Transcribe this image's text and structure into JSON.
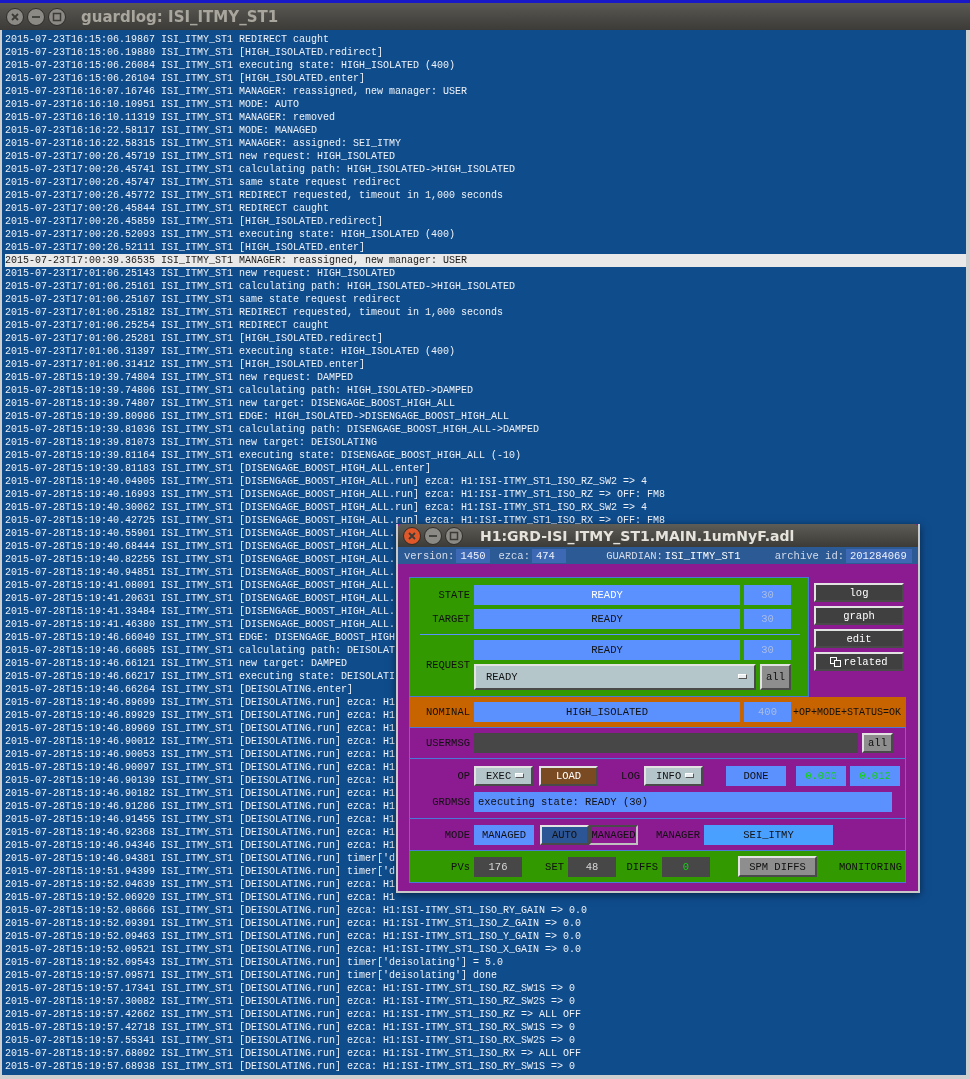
{
  "window": {
    "title": "guardlog: ISI_ITMY_ST1"
  },
  "log": {
    "lines": [
      {
        "text": "2015-07-23T16:15:06.19867 ISI_ITMY_ST1 REDIRECT caught",
        "selected": false
      },
      {
        "text": "2015-07-23T16:15:06.19880 ISI_ITMY_ST1 [HIGH_ISOLATED.redirect]",
        "selected": false
      },
      {
        "text": "2015-07-23T16:15:06.26084 ISI_ITMY_ST1 executing state: HIGH_ISOLATED (400)",
        "selected": false
      },
      {
        "text": "2015-07-23T16:15:06.26104 ISI_ITMY_ST1 [HIGH_ISOLATED.enter]",
        "selected": false
      },
      {
        "text": "2015-07-23T16:16:07.16746 ISI_ITMY_ST1 MANAGER: reassigned, new manager: USER",
        "selected": false
      },
      {
        "text": "2015-07-23T16:16:10.10951 ISI_ITMY_ST1 MODE: AUTO",
        "selected": false
      },
      {
        "text": "2015-07-23T16:16:10.11319 ISI_ITMY_ST1 MANAGER: removed",
        "selected": false
      },
      {
        "text": "2015-07-23T16:16:22.58117 ISI_ITMY_ST1 MODE: MANAGED",
        "selected": false
      },
      {
        "text": "2015-07-23T16:16:22.58315 ISI_ITMY_ST1 MANAGER: assigned: SEI_ITMY",
        "selected": false
      },
      {
        "text": "2015-07-23T17:00:26.45719 ISI_ITMY_ST1 new request: HIGH_ISOLATED",
        "selected": false
      },
      {
        "text": "2015-07-23T17:00:26.45741 ISI_ITMY_ST1 calculating path: HIGH_ISOLATED->HIGH_ISOLATED",
        "selected": false
      },
      {
        "text": "2015-07-23T17:00:26.45747 ISI_ITMY_ST1 same state request redirect",
        "selected": false
      },
      {
        "text": "2015-07-23T17:00:26.45772 ISI_ITMY_ST1 REDIRECT requested, timeout in 1,000 seconds",
        "selected": false
      },
      {
        "text": "2015-07-23T17:00:26.45844 ISI_ITMY_ST1 REDIRECT caught",
        "selected": false
      },
      {
        "text": "2015-07-23T17:00:26.45859 ISI_ITMY_ST1 [HIGH_ISOLATED.redirect]",
        "selected": false
      },
      {
        "text": "2015-07-23T17:00:26.52093 ISI_ITMY_ST1 executing state: HIGH_ISOLATED (400)",
        "selected": false
      },
      {
        "text": "2015-07-23T17:00:26.52111 ISI_ITMY_ST1 [HIGH_ISOLATED.enter]",
        "selected": false
      },
      {
        "text": "2015-07-23T17:00:39.36535 ISI_ITMY_ST1 MANAGER: reassigned, new manager: USER",
        "selected": true
      },
      {
        "text": "2015-07-23T17:01:06.25143 ISI_ITMY_ST1 new request: HIGH_ISOLATED",
        "selected": false
      },
      {
        "text": "2015-07-23T17:01:06.25161 ISI_ITMY_ST1 calculating path: HIGH_ISOLATED->HIGH_ISOLATED",
        "selected": false
      },
      {
        "text": "2015-07-23T17:01:06.25167 ISI_ITMY_ST1 same state request redirect",
        "selected": false
      },
      {
        "text": "2015-07-23T17:01:06.25182 ISI_ITMY_ST1 REDIRECT requested, timeout in 1,000 seconds",
        "selected": false
      },
      {
        "text": "2015-07-23T17:01:06.25254 ISI_ITMY_ST1 REDIRECT caught",
        "selected": false
      },
      {
        "text": "2015-07-23T17:01:06.25281 ISI_ITMY_ST1 [HIGH_ISOLATED.redirect]",
        "selected": false
      },
      {
        "text": "2015-07-23T17:01:06.31397 ISI_ITMY_ST1 executing state: HIGH_ISOLATED (400)",
        "selected": false
      },
      {
        "text": "2015-07-23T17:01:06.31412 ISI_ITMY_ST1 [HIGH_ISOLATED.enter]",
        "selected": false
      },
      {
        "text": "2015-07-28T15:19:39.74804 ISI_ITMY_ST1 new request: DAMPED",
        "selected": false
      },
      {
        "text": "2015-07-28T15:19:39.74806 ISI_ITMY_ST1 calculating path: HIGH_ISOLATED->DAMPED",
        "selected": false
      },
      {
        "text": "2015-07-28T15:19:39.74807 ISI_ITMY_ST1 new target: DISENGAGE_BOOST_HIGH_ALL",
        "selected": false
      },
      {
        "text": "2015-07-28T15:19:39.80986 ISI_ITMY_ST1 EDGE: HIGH_ISOLATED->DISENGAGE_BOOST_HIGH_ALL",
        "selected": false
      },
      {
        "text": "2015-07-28T15:19:39.81036 ISI_ITMY_ST1 calculating path: DISENGAGE_BOOST_HIGH_ALL->DAMPED",
        "selected": false
      },
      {
        "text": "2015-07-28T15:19:39.81073 ISI_ITMY_ST1 new target: DEISOLATING",
        "selected": false
      },
      {
        "text": "2015-07-28T15:19:39.81164 ISI_ITMY_ST1 executing state: DISENGAGE_BOOST_HIGH_ALL (-10)",
        "selected": false
      },
      {
        "text": "2015-07-28T15:19:39.81183 ISI_ITMY_ST1 [DISENGAGE_BOOST_HIGH_ALL.enter]",
        "selected": false
      },
      {
        "text": "2015-07-28T15:19:40.04905 ISI_ITMY_ST1 [DISENGAGE_BOOST_HIGH_ALL.run] ezca: H1:ISI-ITMY_ST1_ISO_RZ_SW2 => 4",
        "selected": false
      },
      {
        "text": "2015-07-28T15:19:40.16993 ISI_ITMY_ST1 [DISENGAGE_BOOST_HIGH_ALL.run] ezca: H1:ISI-ITMY_ST1_ISO_RZ => OFF: FM8",
        "selected": false
      },
      {
        "text": "2015-07-28T15:19:40.30062 ISI_ITMY_ST1 [DISENGAGE_BOOST_HIGH_ALL.run] ezca: H1:ISI-ITMY_ST1_ISO_RX_SW2 => 4",
        "selected": false
      },
      {
        "text": "2015-07-28T15:19:40.42725 ISI_ITMY_ST1 [DISENGAGE_BOOST_HIGH_ALL.run] ezca: H1:ISI-ITMY_ST1_ISO_RX => OFF: FM8",
        "selected": false
      },
      {
        "text": "2015-07-28T15:19:40.55901 ISI_ITMY_ST1 [DISENGAGE_BOOST_HIGH_ALL.",
        "selected": false
      },
      {
        "text": "2015-07-28T15:19:40.68444 ISI_ITMY_ST1 [DISENGAGE_BOOST_HIGH_ALL.",
        "selected": false
      },
      {
        "text": "2015-07-28T15:19:40.82255 ISI_ITMY_ST1 [DISENGAGE_BOOST_HIGH_ALL.",
        "selected": false
      },
      {
        "text": "2015-07-28T15:19:40.94851 ISI_ITMY_ST1 [DISENGAGE_BOOST_HIGH_ALL.",
        "selected": false
      },
      {
        "text": "2015-07-28T15:19:41.08091 ISI_ITMY_ST1 [DISENGAGE_BOOST_HIGH_ALL.",
        "selected": false
      },
      {
        "text": "2015-07-28T15:19:41.20631 ISI_ITMY_ST1 [DISENGAGE_BOOST_HIGH_ALL.",
        "selected": false
      },
      {
        "text": "2015-07-28T15:19:41.33484 ISI_ITMY_ST1 [DISENGAGE_BOOST_HIGH_ALL.",
        "selected": false
      },
      {
        "text": "2015-07-28T15:19:41.46380 ISI_ITMY_ST1 [DISENGAGE_BOOST_HIGH_ALL.",
        "selected": false
      },
      {
        "text": "2015-07-28T15:19:46.66040 ISI_ITMY_ST1 EDGE: DISENGAGE_BOOST_HIGH",
        "selected": false
      },
      {
        "text": "2015-07-28T15:19:46.66085 ISI_ITMY_ST1 calculating path: DEISOLAT",
        "selected": false
      },
      {
        "text": "2015-07-28T15:19:46.66121 ISI_ITMY_ST1 new target: DAMPED",
        "selected": false
      },
      {
        "text": "2015-07-28T15:19:46.66217 ISI_ITMY_ST1 executing state: DEISOLATI",
        "selected": false
      },
      {
        "text": "2015-07-28T15:19:46.66264 ISI_ITMY_ST1 [DEISOLATING.enter]",
        "selected": false
      },
      {
        "text": "2015-07-28T15:19:46.89699 ISI_ITMY_ST1 [DEISOLATING.run] ezca: H1",
        "selected": false
      },
      {
        "text": "2015-07-28T15:19:46.89929 ISI_ITMY_ST1 [DEISOLATING.run] ezca: H1",
        "selected": false
      },
      {
        "text": "2015-07-28T15:19:46.89969 ISI_ITMY_ST1 [DEISOLATING.run] ezca: H1",
        "selected": false
      },
      {
        "text": "2015-07-28T15:19:46.90012 ISI_ITMY_ST1 [DEISOLATING.run] ezca: H1",
        "selected": false
      },
      {
        "text": "2015-07-28T15:19:46.90053 ISI_ITMY_ST1 [DEISOLATING.run] ezca: H1",
        "selected": false
      },
      {
        "text": "2015-07-28T15:19:46.90097 ISI_ITMY_ST1 [DEISOLATING.run] ezca: H1",
        "selected": false
      },
      {
        "text": "2015-07-28T15:19:46.90139 ISI_ITMY_ST1 [DEISOLATING.run] ezca: H1",
        "selected": false
      },
      {
        "text": "2015-07-28T15:19:46.90182 ISI_ITMY_ST1 [DEISOLATING.run] ezca: H1",
        "selected": false
      },
      {
        "text": "2015-07-28T15:19:46.91286 ISI_ITMY_ST1 [DEISOLATING.run] ezca: H1",
        "selected": false
      },
      {
        "text": "2015-07-28T15:19:46.91455 ISI_ITMY_ST1 [DEISOLATING.run] ezca: H1",
        "selected": false
      },
      {
        "text": "2015-07-28T15:19:46.92368 ISI_ITMY_ST1 [DEISOLATING.run] ezca: H1",
        "selected": false
      },
      {
        "text": "2015-07-28T15:19:46.94346 ISI_ITMY_ST1 [DEISOLATING.run] ezca: H1",
        "selected": false
      },
      {
        "text": "2015-07-28T15:19:46.94381 ISI_ITMY_ST1 [DEISOLATING.run] timer['d",
        "selected": false
      },
      {
        "text": "2015-07-28T15:19:51.94399 ISI_ITMY_ST1 [DEISOLATING.run] timer['d",
        "selected": false
      },
      {
        "text": "2015-07-28T15:19:52.04639 ISI_ITMY_ST1 [DEISOLATING.run] ezca: H1",
        "selected": false
      },
      {
        "text": "2015-07-28T15:19:52.06920 ISI_ITMY_ST1 [DEISOLATING.run] ezca: H1",
        "selected": false
      },
      {
        "text": "2015-07-28T15:19:52.08666 ISI_ITMY_ST1 [DEISOLATING.run] ezca: H1:ISI-ITMY_ST1_ISO_RY_GAIN => 0.0",
        "selected": false
      },
      {
        "text": "2015-07-28T15:19:52.09391 ISI_ITMY_ST1 [DEISOLATING.run] ezca: H1:ISI-ITMY_ST1_ISO_Z_GAIN => 0.0",
        "selected": false
      },
      {
        "text": "2015-07-28T15:19:52.09463 ISI_ITMY_ST1 [DEISOLATING.run] ezca: H1:ISI-ITMY_ST1_ISO_Y_GAIN => 0.0",
        "selected": false
      },
      {
        "text": "2015-07-28T15:19:52.09521 ISI_ITMY_ST1 [DEISOLATING.run] ezca: H1:ISI-ITMY_ST1_ISO_X_GAIN => 0.0",
        "selected": false
      },
      {
        "text": "2015-07-28T15:19:52.09543 ISI_ITMY_ST1 [DEISOLATING.run] timer['deisolating'] = 5.0",
        "selected": false
      },
      {
        "text": "2015-07-28T15:19:57.09571 ISI_ITMY_ST1 [DEISOLATING.run] timer['deisolating'] done",
        "selected": false
      },
      {
        "text": "2015-07-28T15:19:57.17341 ISI_ITMY_ST1 [DEISOLATING.run] ezca: H1:ISI-ITMY_ST1_ISO_RZ_SW1S => 0",
        "selected": false
      },
      {
        "text": "2015-07-28T15:19:57.30082 ISI_ITMY_ST1 [DEISOLATING.run] ezca: H1:ISI-ITMY_ST1_ISO_RZ_SW2S => 0",
        "selected": false
      },
      {
        "text": "2015-07-28T15:19:57.42662 ISI_ITMY_ST1 [DEISOLATING.run] ezca: H1:ISI-ITMY_ST1_ISO_RZ => ALL OFF",
        "selected": false
      },
      {
        "text": "2015-07-28T15:19:57.42718 ISI_ITMY_ST1 [DEISOLATING.run] ezca: H1:ISI-ITMY_ST1_ISO_RX_SW1S => 0",
        "selected": false
      },
      {
        "text": "2015-07-28T15:19:57.55341 ISI_ITMY_ST1 [DEISOLATING.run] ezca: H1:ISI-ITMY_ST1_ISO_RX_SW2S => 0",
        "selected": false
      },
      {
        "text": "2015-07-28T15:19:57.68092 ISI_ITMY_ST1 [DEISOLATING.run] ezca: H1:ISI-ITMY_ST1_ISO_RX => ALL OFF",
        "selected": false
      },
      {
        "text": "2015-07-28T15:19:57.68938 ISI_ITMY_ST1 [DEISOLATING.run] ezca: H1:ISI-ITMY_ST1_ISO_RY_SW1S => 0",
        "selected": false
      }
    ]
  },
  "control_window": {
    "title": "H1:GRD-ISI_ITMY_ST1.MAIN.1umNyF.adl",
    "header": {
      "version_label": "version:",
      "version": "1450",
      "ezca_label": "ezca:",
      "ezca": "474",
      "guardian_label": "GUARDIAN:",
      "guardian": "ISI_ITMY_ST1",
      "archive_label": "archive id:",
      "archive_id": "201284069"
    },
    "state_rows": [
      {
        "kind": "state",
        "label": "STATE",
        "value": "READY",
        "code": "30"
      },
      {
        "kind": "target",
        "label": "TARGET",
        "value": "READY",
        "code": "30"
      }
    ],
    "request": {
      "label": "REQUEST",
      "value": "READY",
      "code": "30",
      "menu": "READY",
      "all_button": "all"
    },
    "side_buttons": [
      {
        "kind": "plain",
        "label": "log"
      },
      {
        "kind": "plain",
        "label": "graph"
      },
      {
        "kind": "plain",
        "label": "edit"
      },
      {
        "kind": "related",
        "label": "related"
      }
    ],
    "nominal": {
      "label": "NOMINAL",
      "value": "HIGH_ISOLATED",
      "code": "400",
      "status": "+OP+MODE+STATUS=OK"
    },
    "usermsg": {
      "label": "USERMSG",
      "all_button": "all"
    },
    "op": {
      "label": "OP",
      "menu": "EXEC",
      "load_button": "LOAD",
      "log_label": "LOG",
      "log_menu": "INFO",
      "done": "DONE",
      "readings": [
        "0.000",
        "0.012"
      ]
    },
    "grdmsg": {
      "label": "GRDMSG",
      "value": "executing state: READY (30)"
    },
    "mode": {
      "label": "MODE",
      "value": "MANAGED",
      "choices": [
        {
          "label": "AUTO",
          "selected": false
        },
        {
          "label": "MANAGED",
          "selected": true
        }
      ],
      "manager_label": "MANAGER",
      "manager": "SEI_ITMY"
    },
    "monitor": {
      "pvs_label": "PVs",
      "pvs": "176",
      "set_label": "SET",
      "set": "48",
      "diffs_label": "DIFFS",
      "diffs": "0",
      "spm_button": "SPM DIFFS",
      "status": "MONITORING"
    }
  }
}
